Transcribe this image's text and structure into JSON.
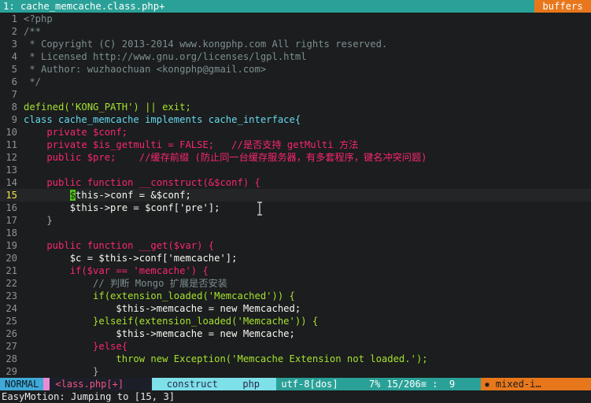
{
  "tabline": {
    "active_tab": "1: cache_memcache.class.php+",
    "buffers_label": "buffers"
  },
  "code_lines": [
    {
      "n": "1",
      "text": "<?php"
    },
    {
      "n": "2",
      "text": "/**"
    },
    {
      "n": "3",
      "text": " * Copyright (C) 2013-2014 www.kongphp.com All rights reserved."
    },
    {
      "n": "4",
      "text": " * Licensed http://www.gnu.org/licenses/lgpl.html"
    },
    {
      "n": "5",
      "text": " * Author: wuzhaochuan <kongphp@gmail.com>"
    },
    {
      "n": "6",
      "text": " */"
    },
    {
      "n": "7",
      "text": ""
    },
    {
      "n": "8",
      "text": "defined('KONG_PATH') || exit;"
    },
    {
      "n": "9",
      "text": "class cache_memcache implements cache_interface{"
    },
    {
      "n": "10",
      "text": "    private $conf;"
    },
    {
      "n": "11",
      "text": "    private $is_getmulti = FALSE;   //是否支持 getMulti 方法"
    },
    {
      "n": "12",
      "text": "    public $pre;    //缓存前缀 (防止同一台缓存服务器，有多套程序，键名冲突问题)"
    },
    {
      "n": "13",
      "text": ""
    },
    {
      "n": "14",
      "text": "    public function __construct(&$conf) {"
    },
    {
      "n": "15",
      "text": "        $this->conf = &$conf;"
    },
    {
      "n": "16",
      "text": "        $this->pre = $conf['pre'];"
    },
    {
      "n": "17",
      "text": "    }"
    },
    {
      "n": "18",
      "text": ""
    },
    {
      "n": "19",
      "text": "    public function __get($var) {"
    },
    {
      "n": "20",
      "text": "        $c = $this->conf['memcache'];"
    },
    {
      "n": "21",
      "text": "        if($var == 'memcache') {"
    },
    {
      "n": "22",
      "text": "            // 判断 Mongo 扩展是否安装"
    },
    {
      "n": "23",
      "text": "            if(extension_loaded('Memcached')) {"
    },
    {
      "n": "24",
      "text": "                $this->memcache = new Memcached;"
    },
    {
      "n": "25",
      "text": "            }elseif(extension_loaded('Memcache')) {"
    },
    {
      "n": "26",
      "text": "                $this->memcache = new Memcache;"
    },
    {
      "n": "27",
      "text": "            }else{"
    },
    {
      "n": "28",
      "text": "                throw new Exception('Memcache Extension not loaded.');"
    },
    {
      "n": "29",
      "text": "            }"
    }
  ],
  "current_line": "15",
  "statusline": {
    "mode": "NORMAL",
    "file": "<lass.php[+]",
    "function": "  construct",
    "filetype": "php",
    "encoding": "utf-8[dos]",
    "percent": "7%",
    "position": "15/206≡ :  9",
    "warning": "✹ mixed-i…"
  },
  "cmdline": "EasyMotion: Jumping to [15, 3]",
  "colors": {
    "background": "#1b1d1e",
    "tab_accent": "#2aa198",
    "buffers_accent": "#e8771c",
    "mode_accent": "#3fa9d8",
    "cursor": "#52c41a"
  }
}
